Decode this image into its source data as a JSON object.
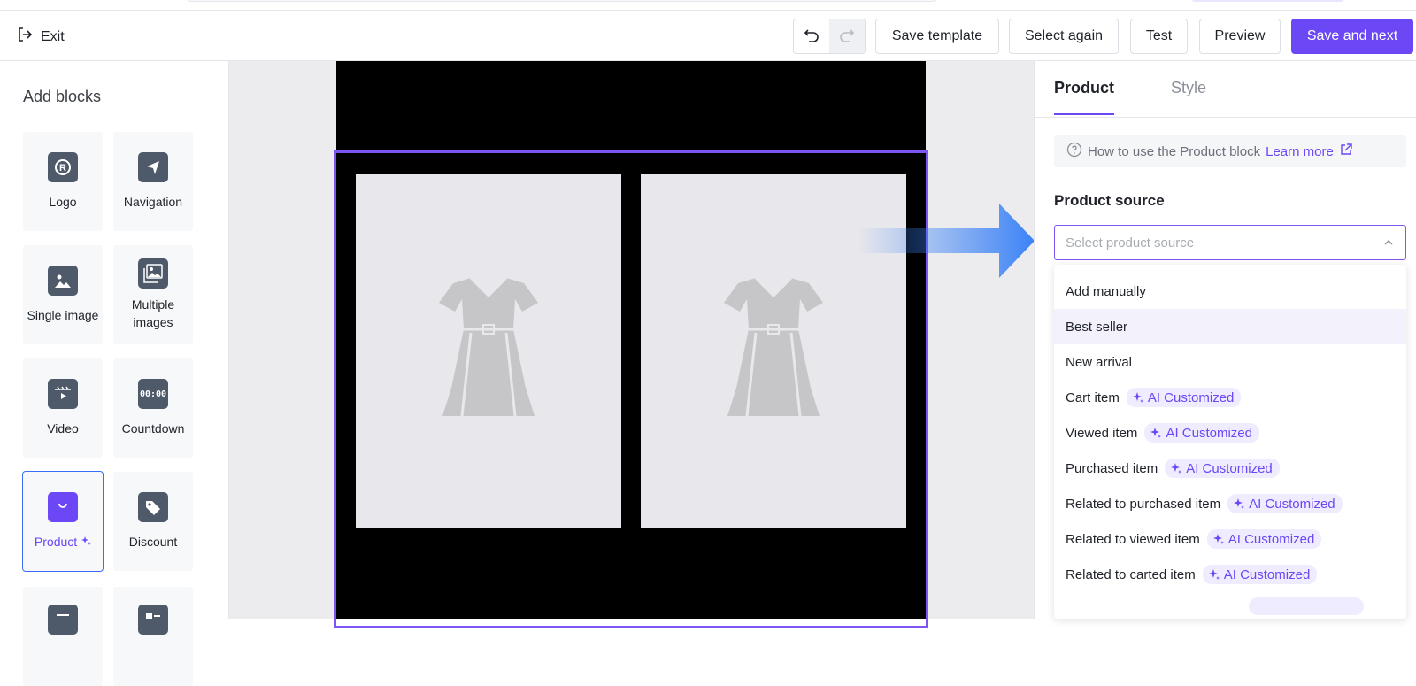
{
  "toolbar": {
    "exit_label": "Exit",
    "save_template": "Save template",
    "select_again": "Select again",
    "test": "Test",
    "preview": "Preview",
    "save_next": "Save and next"
  },
  "sidebar": {
    "title": "Add blocks",
    "blocks": [
      {
        "label": "Logo",
        "icon": "logo-icon"
      },
      {
        "label": "Navigation",
        "icon": "navigation-icon"
      },
      {
        "label": "Single image",
        "icon": "image-icon"
      },
      {
        "label": "Multiple images",
        "icon": "images-icon"
      },
      {
        "label": "Video",
        "icon": "video-icon"
      },
      {
        "label": "Countdown",
        "icon": "countdown-icon",
        "text": "00:00"
      },
      {
        "label": "Product",
        "icon": "shopping-bag-icon",
        "selected": true
      },
      {
        "label": "Discount",
        "icon": "tag-icon"
      }
    ]
  },
  "panel": {
    "tabs": [
      "Product",
      "Style"
    ],
    "help_text": "How to use the Product block",
    "learn_more": "Learn more",
    "section_title": "Product source",
    "select_placeholder": "Select product source",
    "options": [
      {
        "label": "Add manually",
        "badge": ""
      },
      {
        "label": "Best seller",
        "badge": "",
        "highlighted": true
      },
      {
        "label": "New arrival",
        "badge": ""
      },
      {
        "label": "Cart item",
        "badge": "AI Customized"
      },
      {
        "label": "Viewed item",
        "badge": "AI Customized"
      },
      {
        "label": "Purchased item",
        "badge": "AI Customized"
      },
      {
        "label": "Related to purchased item",
        "badge": "AI Customized"
      },
      {
        "label": "Related to viewed item",
        "badge": "AI Customized"
      },
      {
        "label": "Related to carted item",
        "badge": "AI Customized"
      }
    ]
  },
  "colors": {
    "accent": "#6b47f5",
    "selection_border": "#7b56f2"
  }
}
